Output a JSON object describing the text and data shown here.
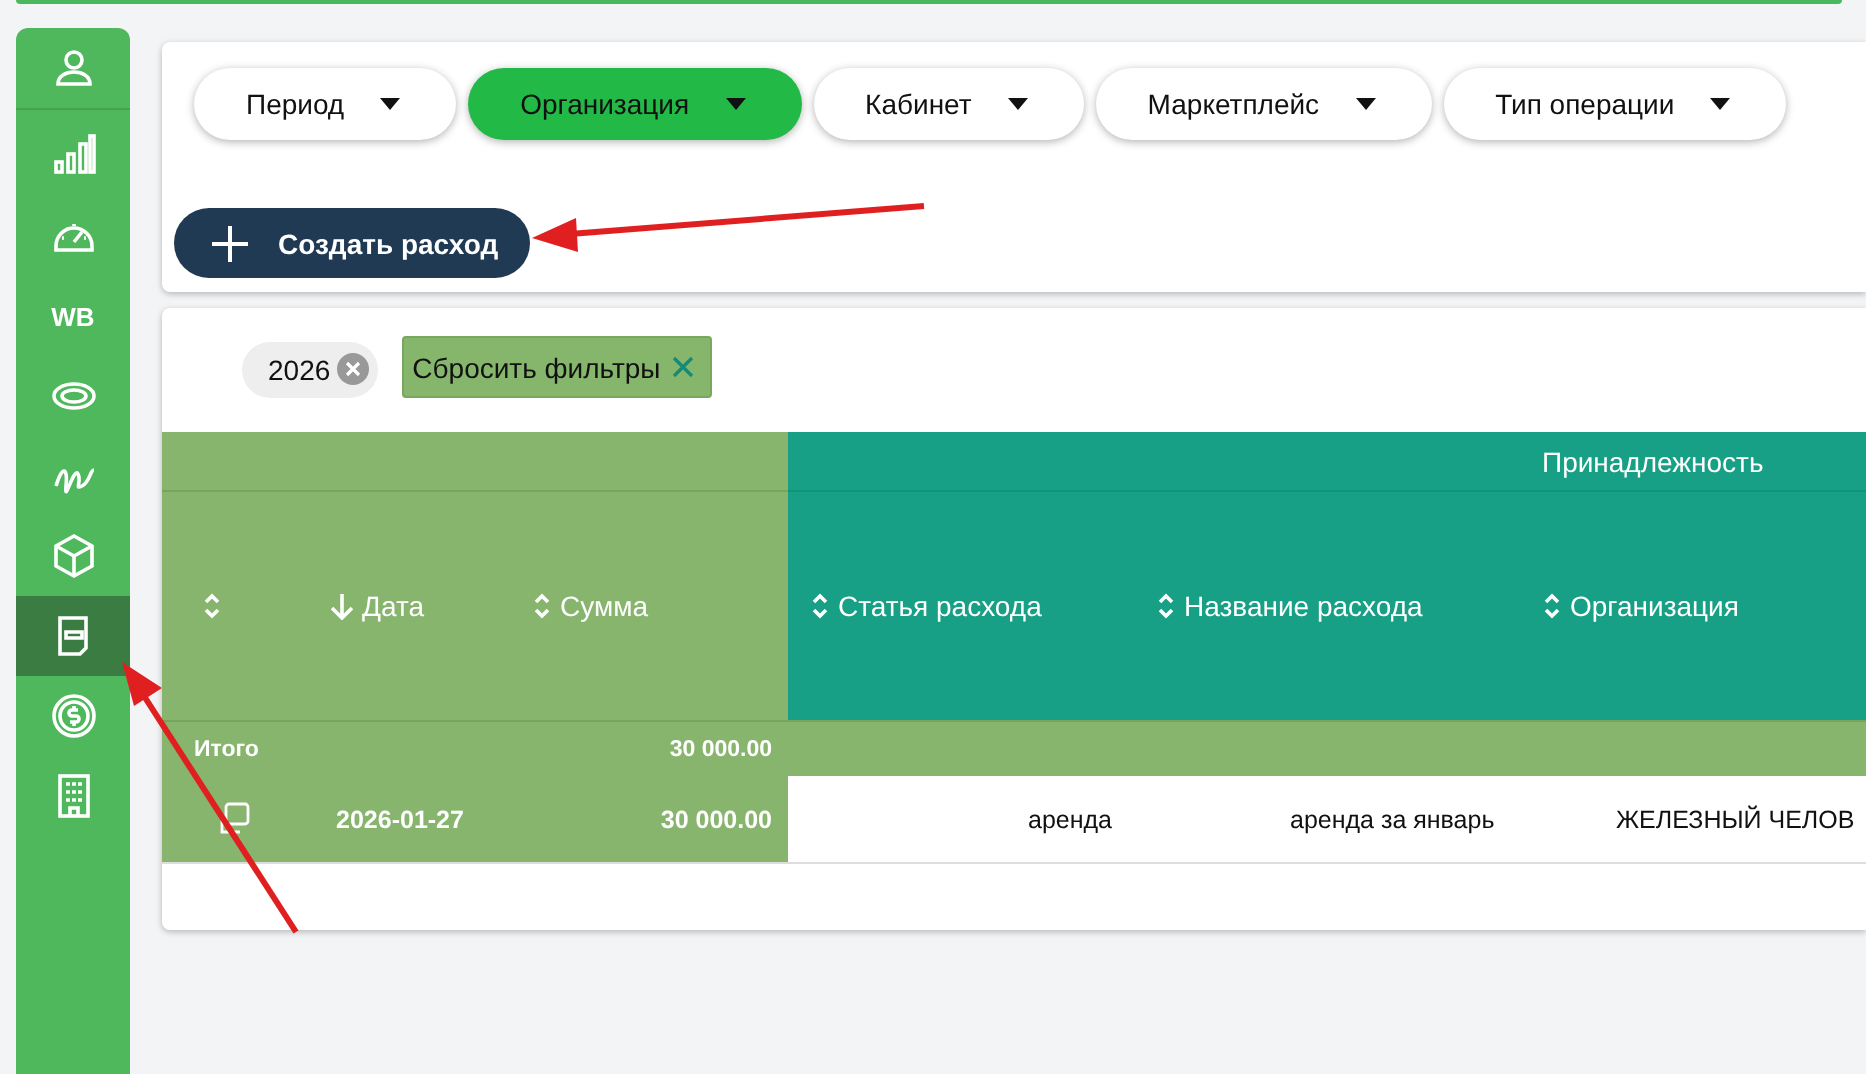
{
  "sidebar": {
    "items": [
      {
        "selected": false
      },
      {
        "selected": false
      },
      {
        "selected": false
      },
      {
        "label": "WB",
        "selected": false
      },
      {
        "selected": false
      },
      {
        "selected": false
      },
      {
        "selected": false
      },
      {
        "selected": true
      },
      {
        "selected": false
      },
      {
        "selected": false
      }
    ]
  },
  "filters": [
    {
      "label": "Период",
      "selected": false
    },
    {
      "label": "Организация",
      "selected": true
    },
    {
      "label": "Кабинет",
      "selected": false
    },
    {
      "label": "Маркетплейс",
      "selected": false
    },
    {
      "label": "Тип операции",
      "selected": false
    }
  ],
  "create_button": {
    "label": "Создать расход"
  },
  "active_filters": [
    {
      "label": "2026"
    }
  ],
  "reset_button": {
    "label": "Сбросить фильтры"
  },
  "table": {
    "group_header": "Принадлежность",
    "columns": [
      {
        "sorted": false
      },
      {
        "label": "Дата",
        "sorted": true
      },
      {
        "label": "Сумма",
        "sorted": false
      },
      {
        "label": "Статья расхода",
        "sorted": false
      },
      {
        "label": "Название расхода",
        "sorted": false
      },
      {
        "label": "Организация",
        "sorted": false
      }
    ],
    "total_row": {
      "label": "Итого",
      "sum": "30 000.00"
    },
    "rows": [
      {
        "date": "2026-01-27",
        "sum": "30 000.00",
        "article": "аренда",
        "name": "аренда за январь",
        "organization": "ЖЕЛЕЗНЫЙ ЧЕЛОВ"
      }
    ]
  }
}
